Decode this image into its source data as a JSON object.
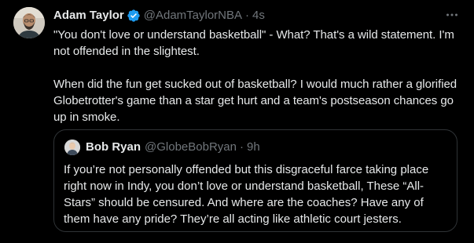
{
  "tweet": {
    "display_name": "Adam Taylor",
    "handle": "@AdamTaylorNBA",
    "separator": "·",
    "time": "4s",
    "text": "\"You don't love or understand basketball\" - What? That's a wild statement. I'm not offended in the slightest.\n\nWhen did the fun get sucked out of basketball? I would much rather a glorified Globetrotter's game than a star get hurt and a team's postseason chances go up in smoke.",
    "verified_icon": "verified-badge-icon",
    "more_icon": "more-options-icon"
  },
  "quote": {
    "display_name": "Bob Ryan",
    "handle": "@GlobeBobRyan",
    "separator": "·",
    "time": "9h",
    "text": "If you’re not personally offended but this disgraceful farce taking place right now in Indy, you don’t love or understand basketball, These “All-Stars” should be censured.  And where are the coaches? Have any of them have any pride? They’re all acting like athletic court jesters."
  },
  "colors": {
    "background": "#000000",
    "text": "#e7e9ea",
    "secondary": "#71767b",
    "verified": "#1d9bf0",
    "border": "#2f3336"
  }
}
